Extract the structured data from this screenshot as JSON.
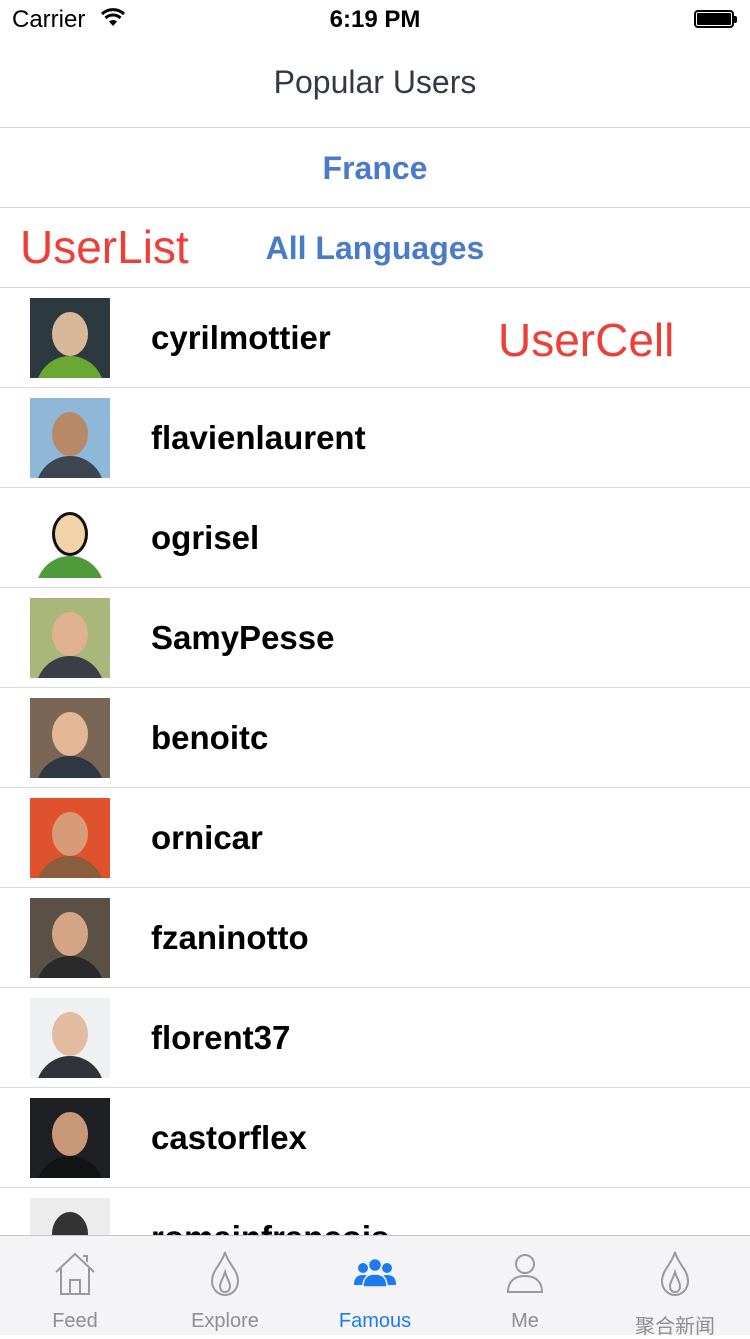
{
  "status_bar": {
    "carrier": "Carrier",
    "time": "6:19 PM"
  },
  "nav": {
    "title": "Popular Users"
  },
  "filters": {
    "country": "France",
    "language": "All Languages"
  },
  "annotations": {
    "user_list": "UserList",
    "user_cell": "UserCell"
  },
  "users": [
    {
      "name": "cyrilmottier"
    },
    {
      "name": "flavienlaurent"
    },
    {
      "name": "ogrisel"
    },
    {
      "name": "SamyPesse"
    },
    {
      "name": "benoitc"
    },
    {
      "name": "ornicar"
    },
    {
      "name": "fzaninotto"
    },
    {
      "name": "florent37"
    },
    {
      "name": "castorflex"
    },
    {
      "name": "romainfrancois"
    }
  ],
  "tabs": [
    {
      "label": "Feed",
      "icon": "home-icon"
    },
    {
      "label": "Explore",
      "icon": "flame-icon"
    },
    {
      "label": "Famous",
      "icon": "people-icon",
      "active": true
    },
    {
      "label": "Me",
      "icon": "person-icon"
    },
    {
      "label": "聚合新闻",
      "icon": "flame-icon"
    }
  ],
  "colors": {
    "accent": "#4a7bc8",
    "active_tab": "#1d7bf0",
    "annotation": "#ef3e36"
  }
}
